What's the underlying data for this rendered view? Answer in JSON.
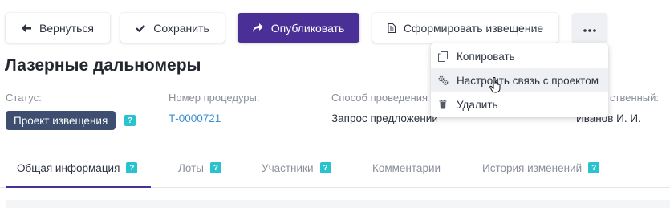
{
  "toolbar": {
    "back_label": "Вернуться",
    "save_label": "Сохранить",
    "publish_label": "Опубликовать",
    "generate_notice_label": "Сформировать извещение",
    "more_label": "•••"
  },
  "dropdown": {
    "items": [
      {
        "label": "Копировать",
        "icon": "copy-icon"
      },
      {
        "label": "Настроить связь с проектом",
        "icon": "gears-icon"
      },
      {
        "label": "Удалить",
        "icon": "trash-icon"
      }
    ]
  },
  "page": {
    "title": "Лазерные дальномеры"
  },
  "fields": {
    "status_label": "Статус:",
    "status_value": "Проект извещения",
    "procedure_number_label": "Номер процедуры:",
    "procedure_number_value": "Т-0000721",
    "method_label": "Способ проведения",
    "method_value": "Запрос предложений",
    "responsible_label": "ственный:",
    "responsible_value": "Иванов И. И."
  },
  "help_glyph": "?",
  "tabs": [
    {
      "label": "Общая информация",
      "help": true,
      "active": true
    },
    {
      "label": "Лоты",
      "help": true,
      "active": false
    },
    {
      "label": "Участники",
      "help": true,
      "active": false
    },
    {
      "label": "Комментарии",
      "help": false,
      "active": false
    },
    {
      "label": "История изменений",
      "help": true,
      "active": false
    }
  ],
  "colors": {
    "primary": "#4a2f96",
    "status_badge": "#3e4e70",
    "help_badge": "#28c3cc",
    "link": "#3b8fcf"
  }
}
